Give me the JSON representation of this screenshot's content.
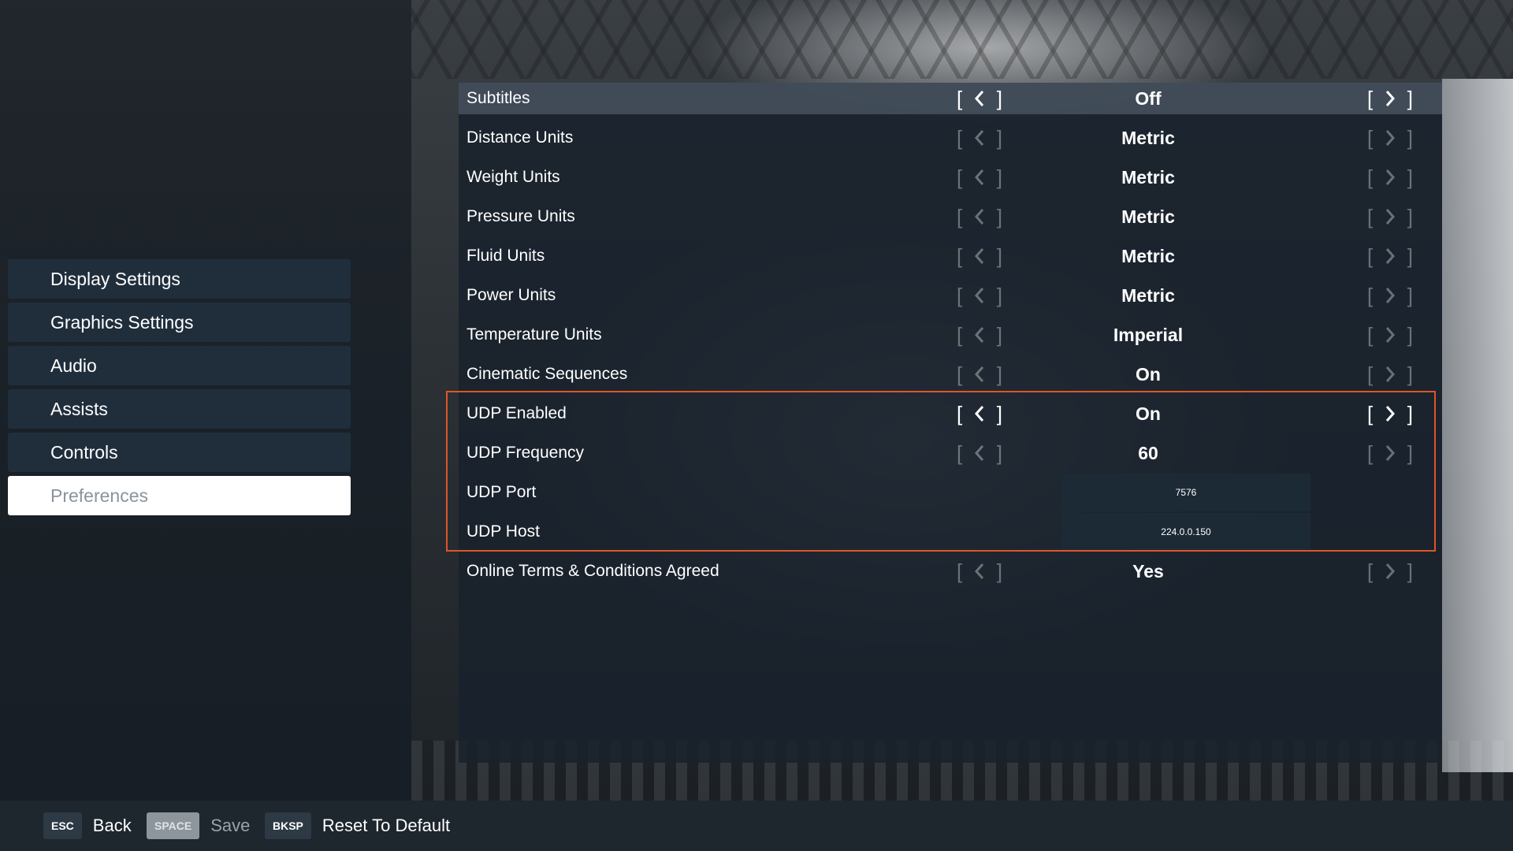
{
  "sidebar": {
    "items": [
      {
        "label": "Display Settings"
      },
      {
        "label": "Graphics Settings"
      },
      {
        "label": "Audio"
      },
      {
        "label": "Assists"
      },
      {
        "label": "Controls"
      },
      {
        "label": "Preferences",
        "active": true
      }
    ]
  },
  "settings": {
    "rows": [
      {
        "label": "Subtitles",
        "value": "Off"
      },
      {
        "label": "Distance Units",
        "value": "Metric"
      },
      {
        "label": "Weight Units",
        "value": "Metric"
      },
      {
        "label": "Pressure Units",
        "value": "Metric"
      },
      {
        "label": "Fluid Units",
        "value": "Metric"
      },
      {
        "label": "Power Units",
        "value": "Metric"
      },
      {
        "label": "Temperature Units",
        "value": "Imperial"
      },
      {
        "label": "Cinematic Sequences",
        "value": "On"
      },
      {
        "label": "UDP Enabled",
        "value": "On"
      },
      {
        "label": "UDP Frequency",
        "value": "60"
      },
      {
        "label": "UDP Port",
        "value": "7576"
      },
      {
        "label": "UDP Host",
        "value": "224.0.0.150"
      },
      {
        "label": "Online Terms & Conditions Agreed",
        "value": "Yes"
      }
    ]
  },
  "footer": {
    "back": {
      "key": "ESC",
      "label": "Back"
    },
    "save": {
      "key": "SPACE",
      "label": "Save"
    },
    "reset": {
      "key": "BKSP",
      "label": "Reset To Default"
    }
  },
  "colors": {
    "highlight_border": "#e0542a",
    "active_nav_bg": "#ffffff",
    "nav_bg": "#21303e"
  }
}
